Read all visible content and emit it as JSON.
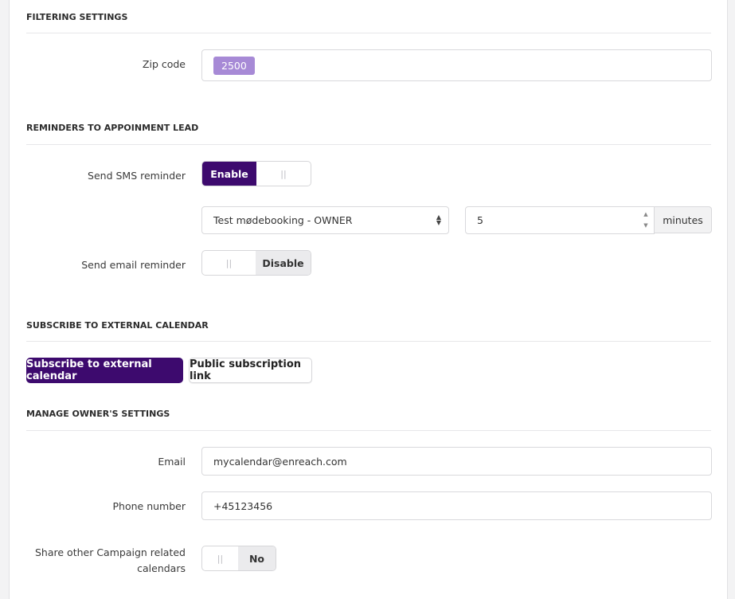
{
  "filtering": {
    "title": "FILTERING SETTINGS",
    "zip_label": "Zip code",
    "zip_tag": "2500"
  },
  "reminders": {
    "title": "REMINDERS TO APPOINMENT LEAD",
    "sms_label": "Send SMS reminder",
    "sms_state": "Enable",
    "sms_knob": "||",
    "template_select": "Test mødebooking - OWNER",
    "minutes_value": "5",
    "minutes_addon": "minutes",
    "email_label": "Send email reminder",
    "email_state": "Disable",
    "email_knob": "||"
  },
  "subscribe": {
    "title": "SUBSCRIBE TO EXTERNAL CALENDAR",
    "subscribe_button": "Subscribe to external calendar",
    "public_link_button": "Public subscription link"
  },
  "owner": {
    "title": "MANAGE OWNER'S SETTINGS",
    "email_label": "Email",
    "email_value": "mycalendar@enreach.com",
    "phone_label": "Phone number",
    "phone_value": "+45123456",
    "share_label_line1": "Share other Campaign related",
    "share_label_line2": "calendars",
    "share_state": "No",
    "share_knob": "||"
  },
  "colors": {
    "primary": "#3d0a6e",
    "tag": "#a78ad6"
  }
}
